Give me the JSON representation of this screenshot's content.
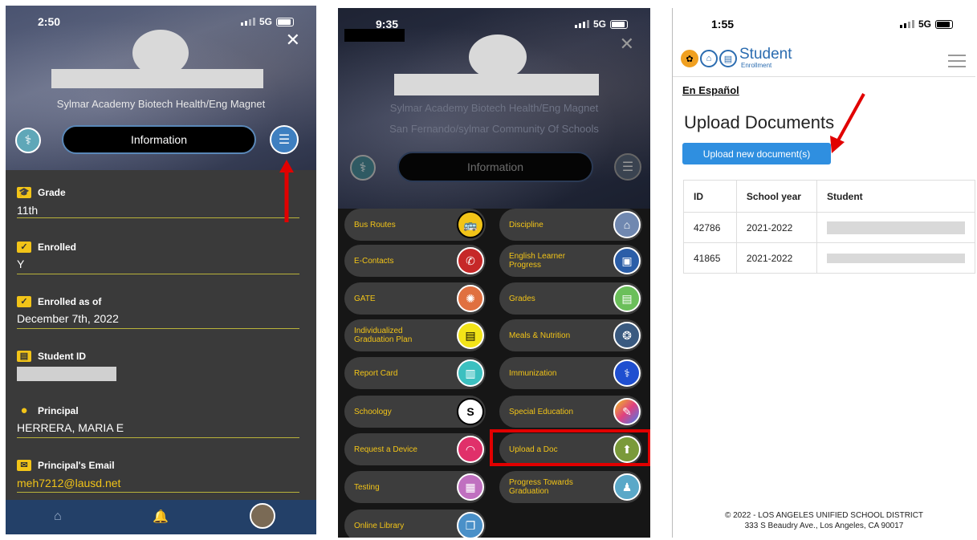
{
  "phone1": {
    "time": "2:50",
    "network": "5G",
    "school": "Sylmar Academy Biotech Health/Eng Magnet",
    "info_button": "Information",
    "fields": [
      {
        "label": "Grade",
        "value": "11th"
      },
      {
        "label": "Enrolled",
        "value": "Y"
      },
      {
        "label": "Enrolled as of",
        "value": "December 7th, 2022"
      },
      {
        "label": "Student ID",
        "value": ""
      },
      {
        "label": "Principal",
        "value": "HERRERA, MARIA E"
      },
      {
        "label": "Principal's Email",
        "value": "meh7212@lausd.net"
      }
    ],
    "icons": {
      "grade": "graduation-cap-icon",
      "check": "checkbox-icon",
      "id": "id-card-icon",
      "person": "person-icon",
      "mail": "mail-icon"
    },
    "colors": {
      "accent": "#f2c418",
      "tabbar": "#234068"
    }
  },
  "phone2": {
    "time": "9:35",
    "network": "5G",
    "school_line1": "Sylmar Academy Biotech Health/Eng Magnet",
    "school_line2": "San Fernando/sylmar Community Of Schools",
    "info_button": "Information",
    "menu_left": [
      "Bus Routes",
      "E-Contacts",
      "GATE",
      "Individualized Graduation Plan",
      "Report Card",
      "Schoology",
      "Request a Device",
      "Testing",
      "Online Library"
    ],
    "menu_right": [
      "Discipline",
      "English Learner Progress",
      "Grades",
      "Meals & Nutrition",
      "Immunization",
      "Special Education",
      "Upload a Doc",
      "Progress Towards Graduation"
    ]
  },
  "phone3": {
    "time": "1:55",
    "network": "5G",
    "logo_title": "Student",
    "logo_sub": "Enrollment",
    "link_spanish": "En Español",
    "heading": "Upload Documents",
    "upload_button": "Upload new document(s)",
    "table": {
      "headers": [
        "ID",
        "School year",
        "Student"
      ],
      "rows": [
        {
          "id": "42786",
          "year": "2021-2022",
          "student": ""
        },
        {
          "id": "41865",
          "year": "2021-2022",
          "student": ""
        }
      ]
    },
    "footer_line1": "© 2022 - LOS ANGELES UNIFIED SCHOOL DISTRICT",
    "footer_line2": "333 S Beaudry Ave., Los Angeles, CA 90017"
  }
}
